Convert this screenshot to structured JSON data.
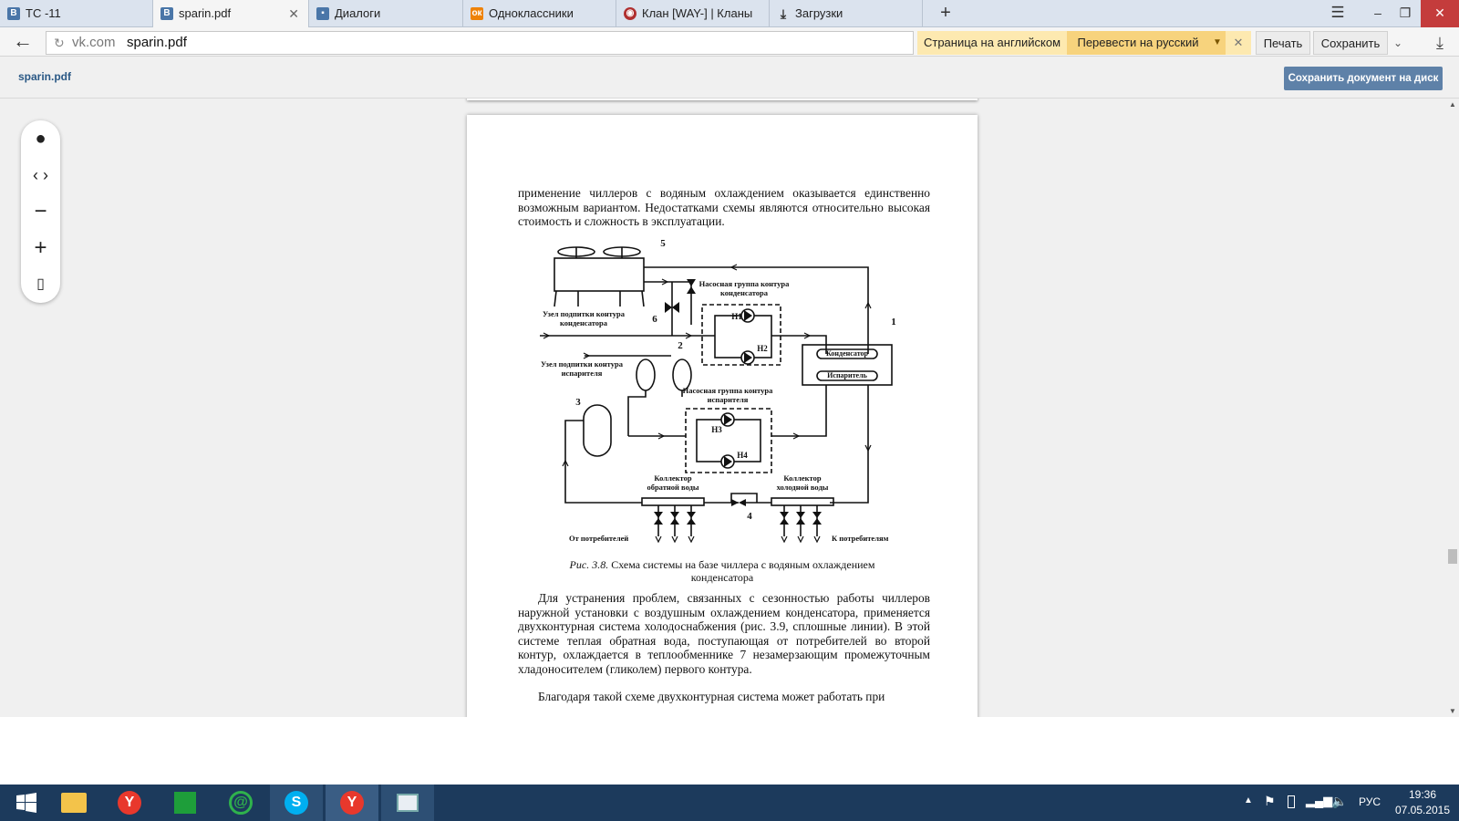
{
  "tabs": [
    {
      "label": "TC -11",
      "favicon": "B",
      "color": "#4a76a8"
    },
    {
      "label": "sparin.pdf",
      "favicon": "B",
      "color": "#4a76a8",
      "active": true
    },
    {
      "label": "Диалоги",
      "favicon": "msg",
      "color": "#4a76a8"
    },
    {
      "label": "Одноклассники",
      "favicon": "ok",
      "color": "#ee8208"
    },
    {
      "label": "Клан [WAY-] | Кланы",
      "favicon": "clan",
      "color": "#b03030"
    },
    {
      "label": "Загрузки",
      "favicon": "download",
      "color": "#333"
    }
  ],
  "address": {
    "domain": "vk.com",
    "path": "sparin.pdf"
  },
  "translate": {
    "page_lang": "Страница на английском",
    "translate_label": "Перевести на русский"
  },
  "toolbar": {
    "print": "Печать",
    "save": "Сохранить"
  },
  "doc": {
    "title": "sparin.pdf",
    "save_button": "Сохранить документ на диск"
  },
  "page": {
    "para1": "применение чиллеров с водяным охлаждением оказывается единственно возможным вариантом. Недостатками схемы являются относительно высокая стоимость и сложность в эксплуатации.",
    "caption_prefix": "Рис. 3.8.",
    "caption": "Схема системы на базе чиллера с водяным охлаждением конденсатора",
    "para2": "Для устранения проблем, связанных с сезонностью работы чиллеров наружной установки с воздушным охлаждением конденсатора, применяется двухконтурная система холодоснабжения (рис. 3.9, сплошные линии). В этой системе теплая обратная вода, поступающая от потребителей во второй контур, охлаждается в теплообменнике 7 незамерзающим промежуточным хладоносителем (гликолем) первого контура.",
    "para3": "Благодаря такой схеме двухконтурная система может работать при"
  },
  "diagram": {
    "num1": "1",
    "num2": "2",
    "num3": "3",
    "num4": "4",
    "num5": "5",
    "num6": "6",
    "pump_cond": "Насосная группа контура конденсатора",
    "pump_evap": "Насосная группа контура испарителя",
    "feed_cond": "Узел подпитки контура конденсатора",
    "feed_evap": "Узел подпитки контура испарителя",
    "condenser": "Конденсатор",
    "evaporator": "Испаритель",
    "h1": "Н1",
    "h2": "Н2",
    "h3": "Н3",
    "h4": "Н4",
    "coll_return": "Коллектор обратной воды",
    "coll_cold": "Коллектор холодной воды",
    "from_cons": "От потребителей",
    "to_cons": "К потребителям"
  },
  "taskbar": {
    "lang": "РУС",
    "time": "19:36",
    "date": "07.05.2015"
  }
}
